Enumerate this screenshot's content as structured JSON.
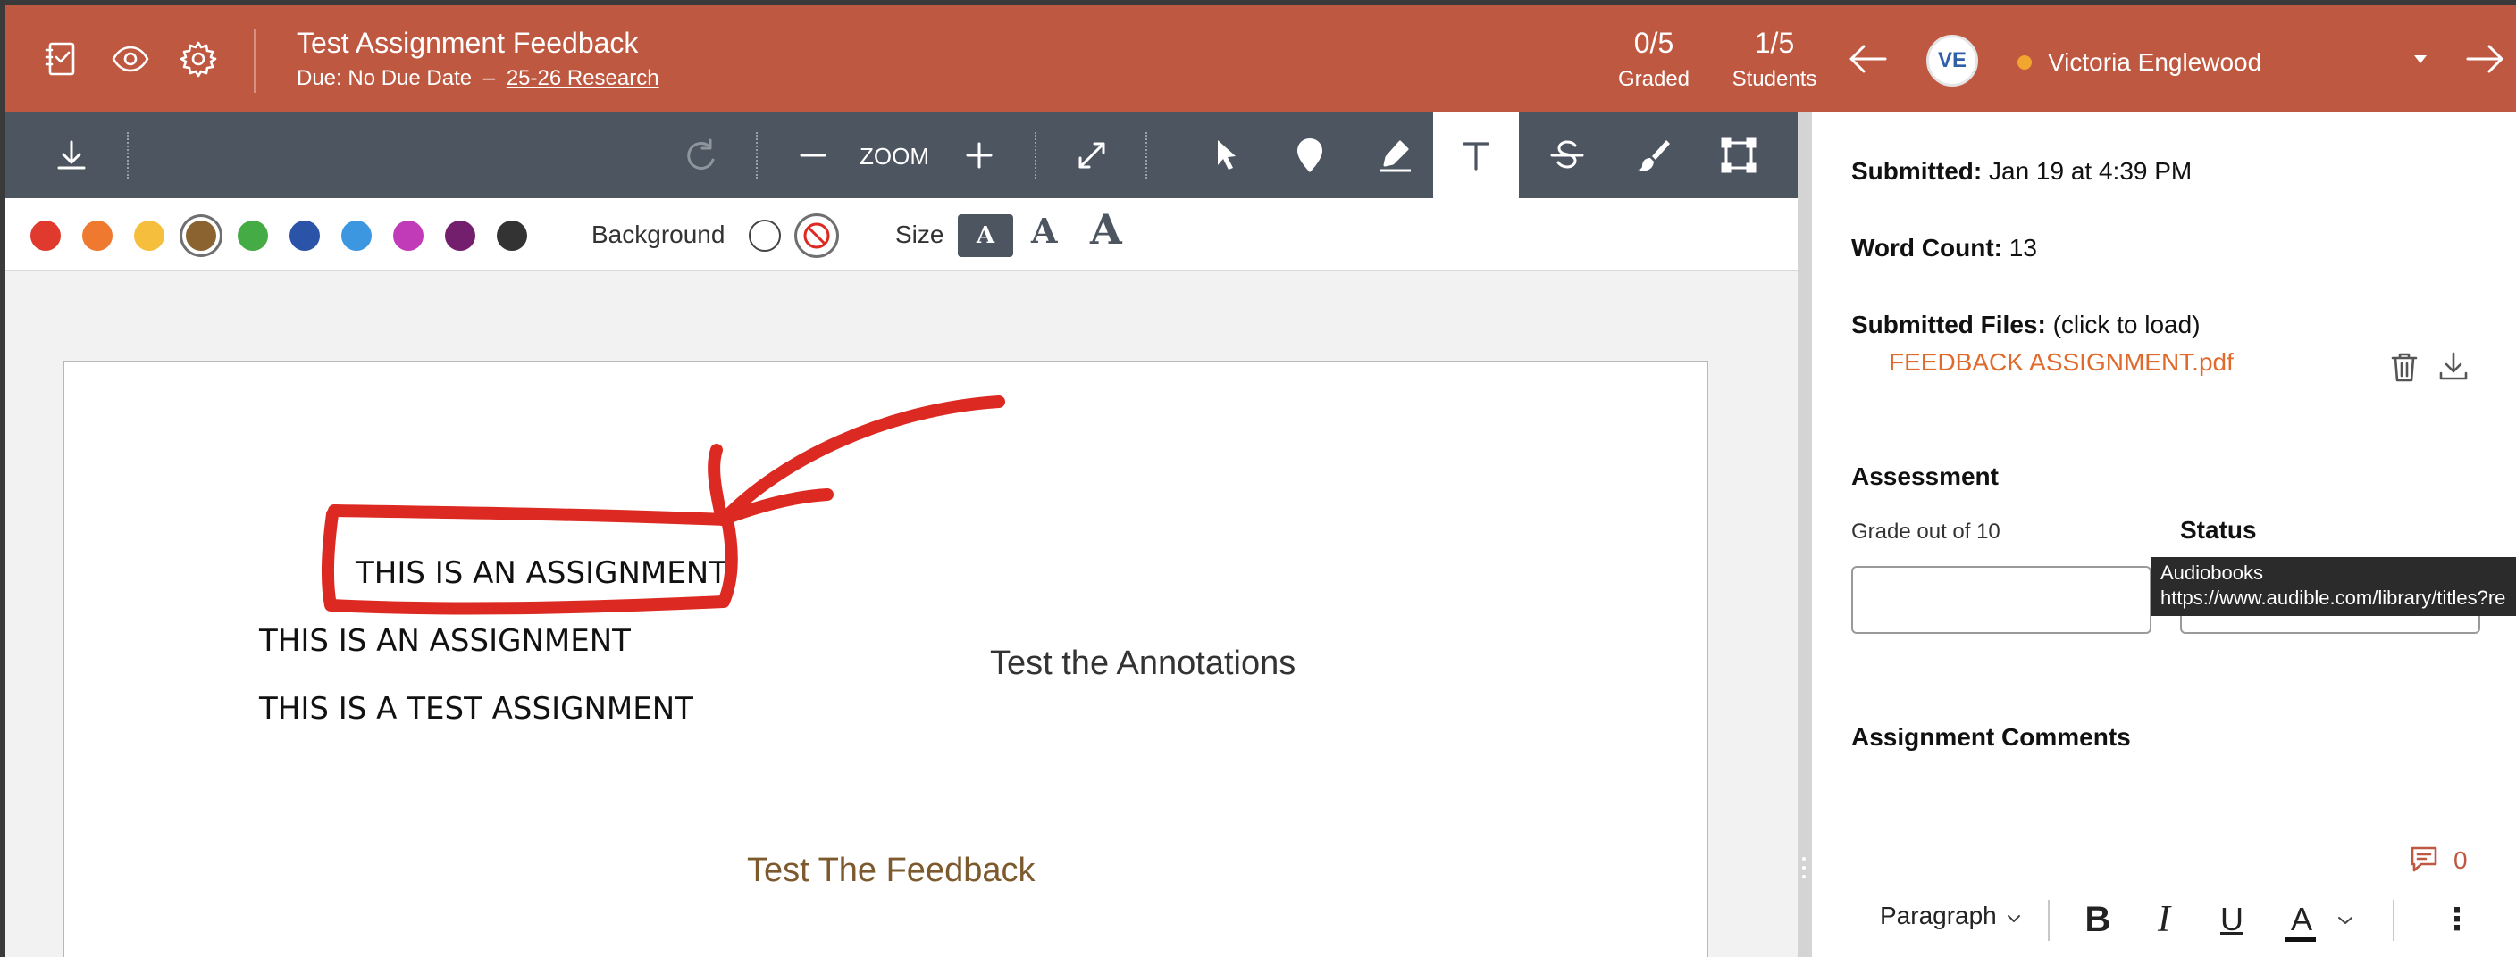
{
  "header": {
    "title": "Test Assignment Feedback",
    "due_text": "Due: No Due Date",
    "due_separator": "–",
    "course_link": "25-26 Research",
    "graded_value": "0/5",
    "graded_label": "Graded",
    "students_value": "1/5",
    "students_label": "Students",
    "student_initials": "VE",
    "student_name": "Victoria Englewood",
    "online_color": "#f2a630"
  },
  "toolbar": {
    "zoom_label": "ZOOM",
    "active_tool": "text-tool"
  },
  "colors": {
    "swatches": [
      "#e03a2f",
      "#ef7a2f",
      "#f5bf3d",
      "#8a6330",
      "#45ab44",
      "#2b54a8",
      "#3d97e0",
      "#c13bb8",
      "#741e6e",
      "#333333"
    ],
    "selected": "#8a6330",
    "background_label": "Background",
    "size_label": "Size",
    "size_glyph": "A"
  },
  "document": {
    "lines": [
      "THIS IS AN ASSIGNMENT",
      "THIS IS AN ASSIGNMENT",
      "THIS IS A TEST ASSIGNMENT"
    ],
    "annotations": [
      {
        "text": "Test the Annotations",
        "color": "#333333"
      },
      {
        "text": "Test The Feedback",
        "color": "#7d5a2e"
      }
    ],
    "ink_color": "#dc2a22"
  },
  "panel": {
    "submitted_label": "Submitted:",
    "submitted_value": "Jan 19 at 4:39 PM",
    "word_count_label": "Word Count:",
    "word_count_value": "13",
    "files_label": "Submitted Files:",
    "files_hint": "(click to load)",
    "file_name": "FEEDBACK ASSIGNMENT.pdf",
    "assessment_heading": "Assessment",
    "grade_label": "Grade out of 10",
    "status_label": "Status",
    "grade_value": "",
    "tooltip_title": "Audiobooks",
    "tooltip_url": "https://www.audible.com/library/titles?re",
    "comments_heading": "Assignment Comments",
    "comment_count": "0"
  },
  "editor": {
    "paragraph_label": "Paragraph",
    "bold": "B",
    "italic": "I",
    "underline": "U",
    "text_color": "A",
    "more": "⋮"
  },
  "theme": {
    "brand": "#bf5841",
    "toolbar": "#4c5560",
    "link": "#e0692c"
  }
}
